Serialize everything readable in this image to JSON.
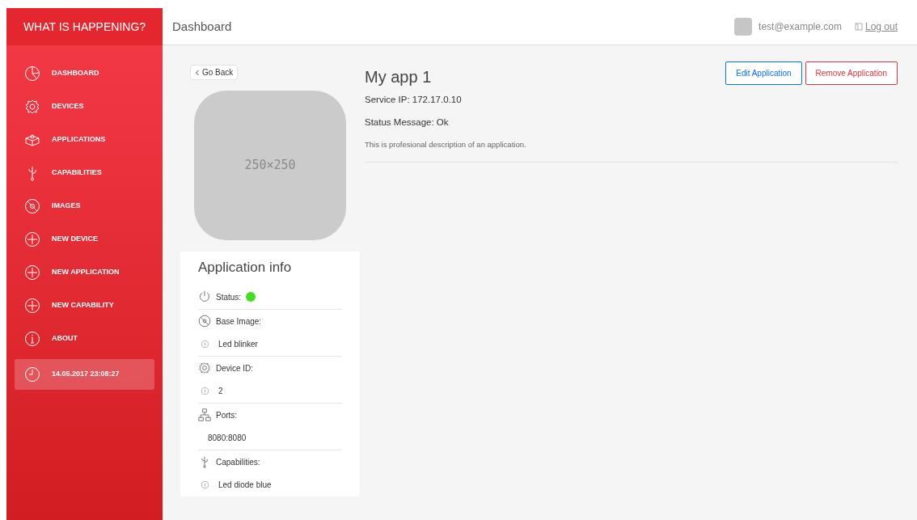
{
  "brand": "WHAT IS HAPPENING?",
  "sidebar": {
    "items": [
      {
        "label": "DASHBOARD",
        "selected": false
      },
      {
        "label": "DEVICES",
        "selected": false
      },
      {
        "label": "APPLICATIONS",
        "selected": false
      },
      {
        "label": "CAPABILITIES",
        "selected": false
      },
      {
        "label": "IMAGES",
        "selected": false
      },
      {
        "label": "NEW DEVICE",
        "selected": false
      },
      {
        "label": "NEW APPLICATION",
        "selected": false
      },
      {
        "label": "NEW CAPABILITY",
        "selected": false
      },
      {
        "label": "ABOUT",
        "selected": false
      },
      {
        "label": "14.05.2017 23:08:27",
        "selected": true
      }
    ]
  },
  "topbar": {
    "title": "Dashboard",
    "user": "test@example.com",
    "logout": "Log out"
  },
  "back_button": "Go Back",
  "image_placeholder": "250×250",
  "app": {
    "name": "My app 1",
    "service_ip": "Service IP: 172.17.0.10",
    "status_message": "Status Message: Ok",
    "description": "This is profesional description of an application."
  },
  "actions": [
    {
      "label": "Edit Application",
      "kind": "primary"
    },
    {
      "label": "Remove Application",
      "kind": "danger"
    }
  ],
  "info": {
    "title": "Application info",
    "rows": [
      {
        "kind": "status",
        "label": "Status:",
        "color": "#44dd22"
      },
      {
        "kind": "field",
        "label": "Base Image:",
        "values": [
          {
            "text": "Led blinker",
            "info": true
          }
        ]
      },
      {
        "kind": "field",
        "label": "Device ID:",
        "values": [
          {
            "text": "2",
            "info": true
          }
        ]
      },
      {
        "kind": "field",
        "label": "Ports:",
        "values": [
          {
            "text": "8080:8080",
            "info": false
          }
        ]
      },
      {
        "kind": "field",
        "label": "Capabilities:",
        "values": [
          {
            "text": "Led diode blue",
            "info": true
          }
        ]
      }
    ]
  }
}
